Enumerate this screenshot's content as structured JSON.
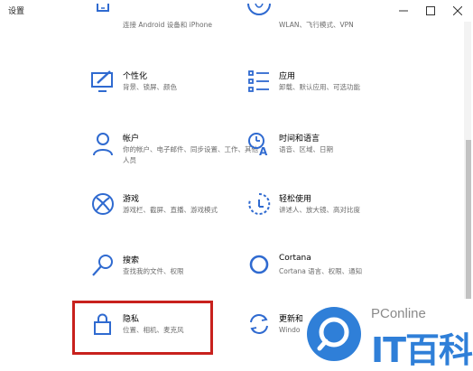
{
  "window": {
    "title": "设置",
    "minimize_icon": "minimize-icon",
    "maximize_icon": "maximize-icon",
    "close_icon": "close-icon"
  },
  "accent_color": "#2f6ad0",
  "highlight_color": "#c8211d",
  "tiles": {
    "phone": {
      "desc": "连接 Android 设备和 iPhone",
      "icon": "phone-icon"
    },
    "network": {
      "desc": "WLAN、飞行模式、VPN",
      "icon": "globe-icon"
    },
    "personalization": {
      "name": "个性化",
      "desc": "背景、锁屏、颜色",
      "icon": "paint-monitor-icon"
    },
    "apps": {
      "name": "应用",
      "desc": "卸载、默认应用、可选功能",
      "icon": "apps-list-icon"
    },
    "accounts": {
      "name": "帐户",
      "desc": "你的帐户、电子邮件、同步设置、工作、其他人员",
      "icon": "person-icon"
    },
    "time_language": {
      "name": "时间和语言",
      "desc": "语音、区域、日期",
      "icon": "time-language-icon"
    },
    "gaming": {
      "name": "游戏",
      "desc": "游戏栏、截屏、直播、游戏模式",
      "icon": "xbox-icon"
    },
    "ease_of_access": {
      "name": "轻松使用",
      "desc": "讲述人、放大镜、高对比度",
      "icon": "ease-of-access-icon"
    },
    "search": {
      "name": "搜索",
      "desc": "查找我的文件、权限",
      "icon": "search-icon"
    },
    "cortana": {
      "name": "Cortana",
      "desc": "Cortana 语言、权限、通知",
      "icon": "cortana-icon"
    },
    "privacy": {
      "name": "隐私",
      "desc": "位置、相机、麦克风",
      "icon": "lock-icon"
    },
    "update": {
      "name": "更新和",
      "desc": "Windo",
      "icon": "sync-icon"
    }
  },
  "watermark": {
    "brand": "PConline",
    "sub": "IT百科"
  }
}
